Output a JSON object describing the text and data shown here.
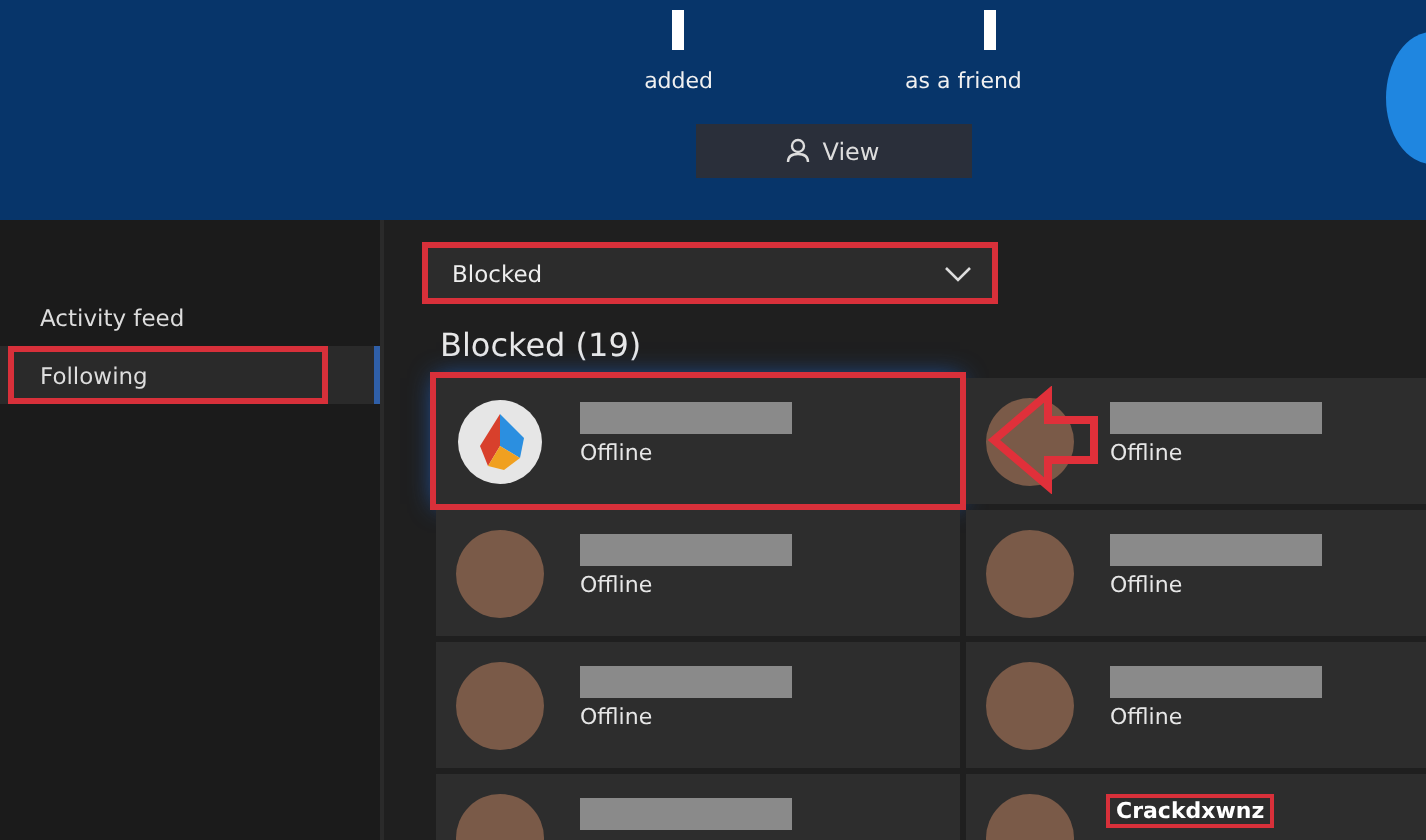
{
  "notification": {
    "text_before": "added",
    "text_after": "as a friend",
    "button": "View"
  },
  "sidebar": {
    "items": [
      {
        "label": "Activity feed",
        "selected": false,
        "highlighted": false
      },
      {
        "label": "Following",
        "selected": true,
        "highlighted": true
      }
    ]
  },
  "filter": {
    "value": "Blocked",
    "highlighted": true
  },
  "section_title": "Blocked (19)",
  "cards": [
    {
      "status": "Offline",
      "highlighted": true,
      "kind": "logo"
    },
    {
      "status": "Offline",
      "highlighted": false,
      "kind": "photo"
    },
    {
      "status": "Offline",
      "highlighted": false,
      "kind": "photo"
    },
    {
      "status": "Offline",
      "highlighted": false,
      "kind": "photo"
    },
    {
      "status": "Offline",
      "highlighted": false,
      "kind": "photo"
    },
    {
      "status": "Offline",
      "highlighted": false,
      "kind": "photo"
    },
    {
      "highlighted": false,
      "kind": "photo"
    },
    {
      "name": "Crackdxwnz",
      "name_highlighted": true,
      "highlighted": false,
      "kind": "photo"
    }
  ]
}
